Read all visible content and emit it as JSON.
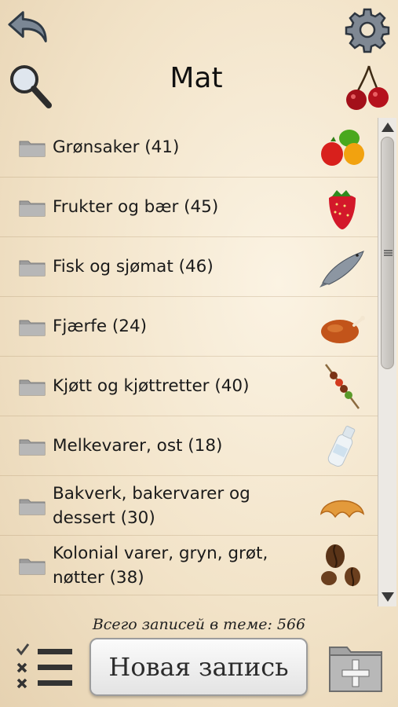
{
  "header": {
    "title": "Mat",
    "icons": [
      "back-arrow-icon",
      "gear-icon",
      "search-icon",
      "cherry-icon"
    ]
  },
  "list": {
    "items": [
      {
        "label": "Grønsaker (41)",
        "icon": "vegetables-icon"
      },
      {
        "label": "Frukter og bær (45)",
        "icon": "strawberry-icon"
      },
      {
        "label": "Fisk og sjømat (46)",
        "icon": "fish-icon"
      },
      {
        "label": "Fjærfe (24)",
        "icon": "roast-chicken-icon"
      },
      {
        "label": "Kjøtt og kjøttretter (40)",
        "icon": "kebab-icon"
      },
      {
        "label": "Melkevarer, ost (18)",
        "icon": "milk-bottle-icon"
      },
      {
        "label": "Bakverk, bakervarer og dessert (30)",
        "icon": "croissant-icon"
      },
      {
        "label": "Kolonial varer, gryn, grøt, nøtter (38)",
        "icon": "coffee-beans-icon"
      }
    ]
  },
  "footer": {
    "total_label": "Всего записей в теме: 566",
    "new_entry_label": "Новая запись",
    "icons": [
      "checklist-icon",
      "add-folder-icon"
    ]
  },
  "colors": {
    "background": "#f4e7cf",
    "button_border": "#9c9c9c"
  }
}
